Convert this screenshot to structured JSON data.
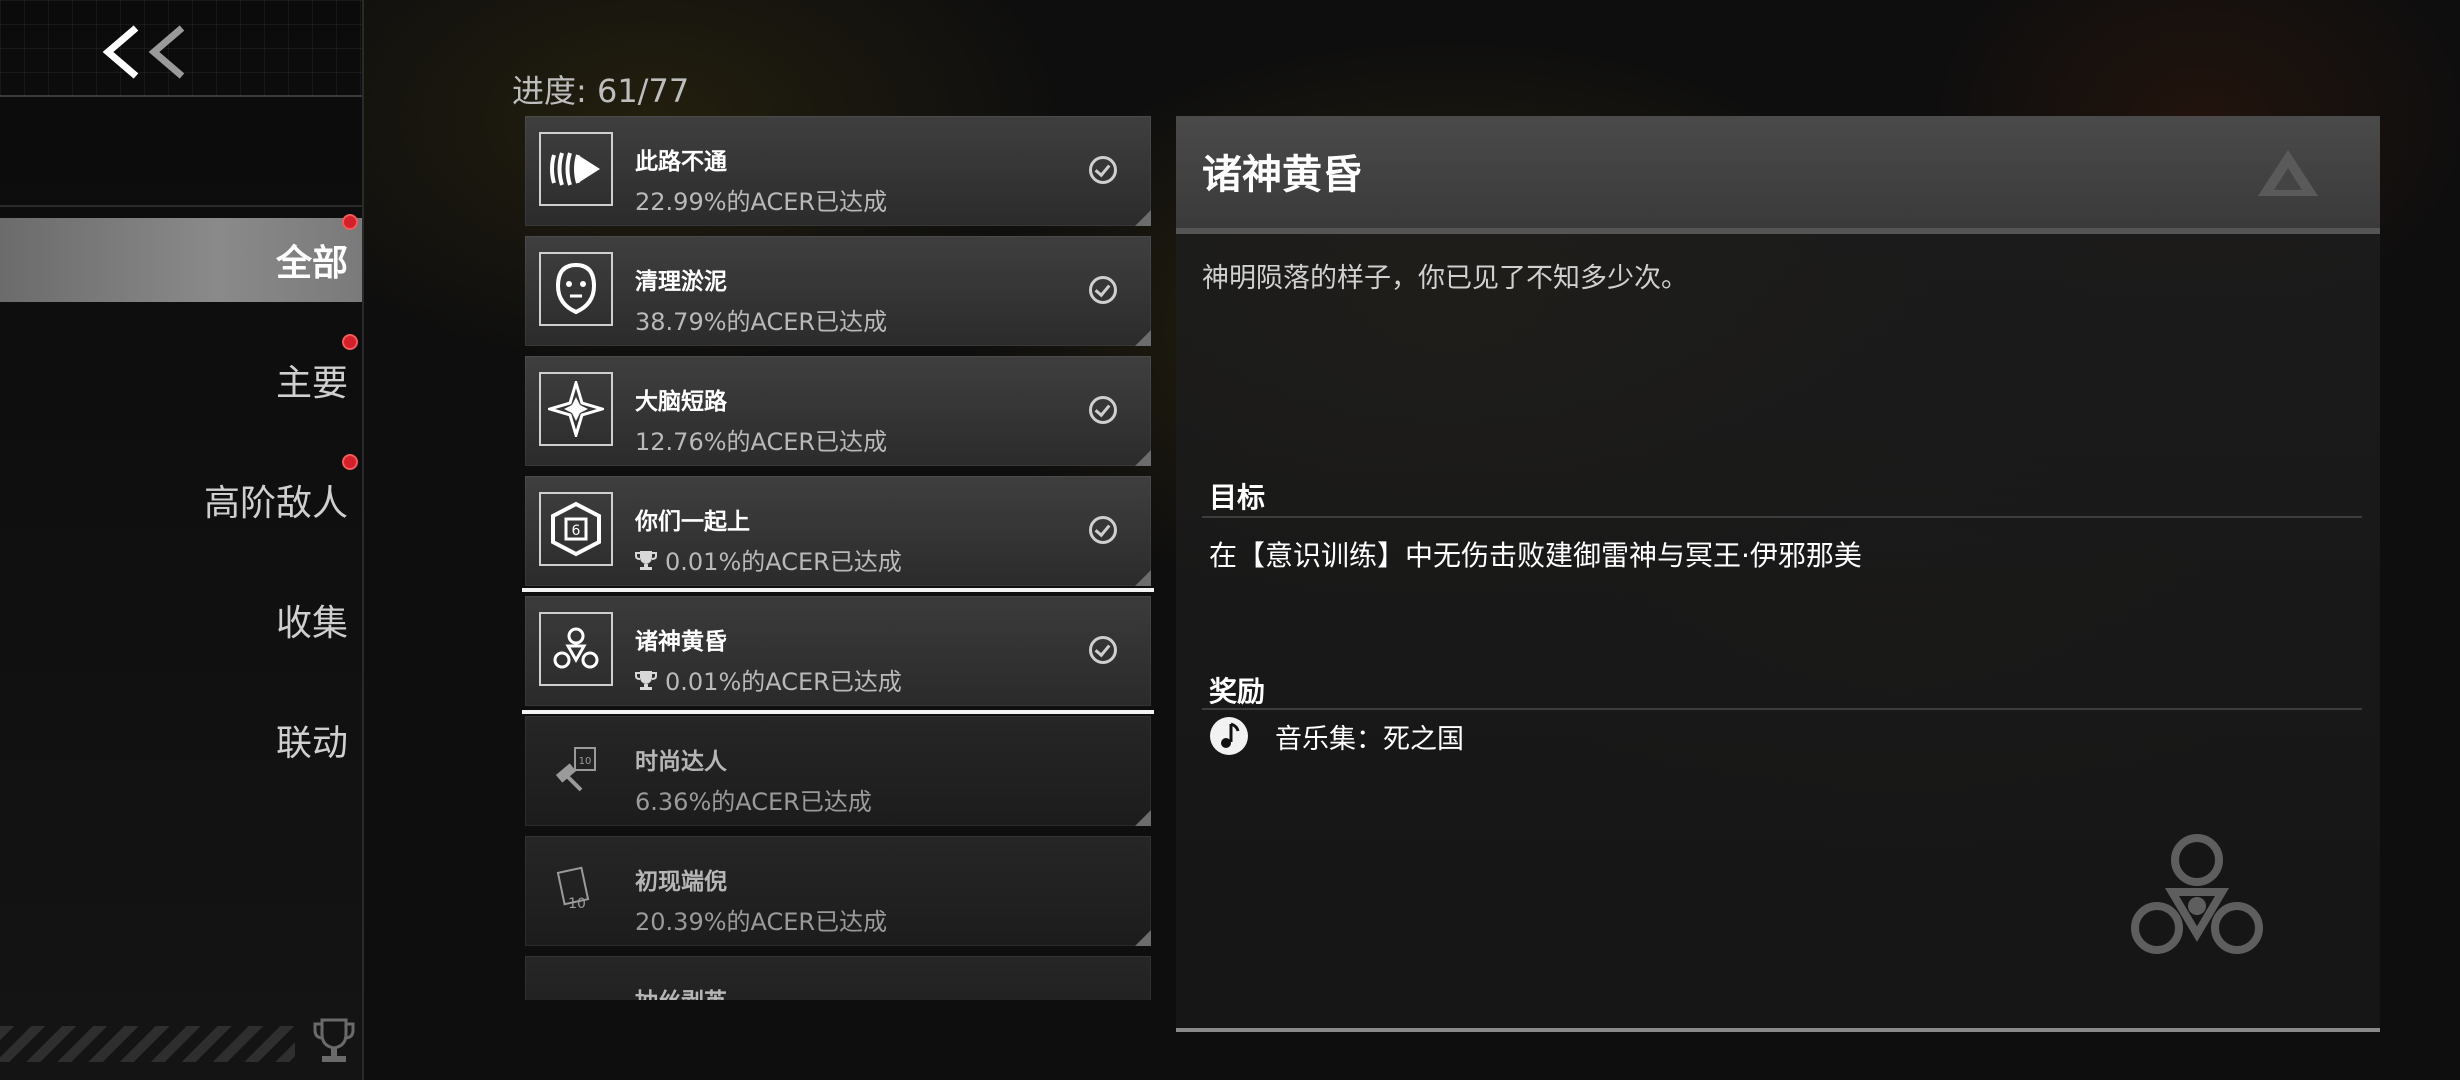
{
  "sidebar": {
    "back_icon": "double-chevron-left-icon",
    "items": [
      {
        "label": "全部",
        "active": true,
        "badge": true
      },
      {
        "label": "主要",
        "active": false,
        "badge": true
      },
      {
        "label": "高阶敌人",
        "active": false,
        "badge": true
      },
      {
        "label": "收集",
        "active": false,
        "badge": false
      },
      {
        "label": "联动",
        "active": false,
        "badge": false
      }
    ],
    "footer_icon": "trophy-icon"
  },
  "progress": {
    "text": "进度: 61/77"
  },
  "achievements": [
    {
      "title": "此路不通",
      "rate": "22.99%的ACER已达成",
      "icon": "fan-blade-icon",
      "completed": true,
      "trophy": false,
      "locked": false
    },
    {
      "title": "清理淤泥",
      "rate": "38.79%的ACER已达成",
      "icon": "mask-face-icon",
      "completed": true,
      "trophy": false,
      "locked": false
    },
    {
      "title": "大脑短路",
      "rate": "12.76%的ACER已达成",
      "icon": "star-burst-icon",
      "completed": true,
      "trophy": false,
      "locked": false
    },
    {
      "title": "你们一起上",
      "rate": "0.01%的ACER已达成",
      "icon": "hexagon-badge-icon",
      "completed": true,
      "trophy": true,
      "locked": false
    },
    {
      "title": "诸神黄昏",
      "rate": "0.01%的ACER已达成",
      "icon": "triad-emblem-icon",
      "completed": true,
      "trophy": true,
      "locked": false,
      "selected": true
    },
    {
      "title": "时尚达人",
      "rate": "6.36%的ACER已达成",
      "icon": "hammer-card-icon",
      "completed": false,
      "trophy": false,
      "locked": true
    },
    {
      "title": "初现端倪",
      "rate": "20.39%的ACER已达成",
      "icon": "card-10-icon",
      "completed": false,
      "trophy": false,
      "locked": true
    },
    {
      "title": "抽丝剥茧",
      "rate": "",
      "icon": "arrow-icon",
      "completed": false,
      "trophy": false,
      "locked": true
    }
  ],
  "detail": {
    "title": "诸神黄昏",
    "description": "神明陨落的样子，你已见了不知多少次。",
    "goal_label": "目标",
    "goal_text": "在【意识训练】中无伤击败建御雷神与冥王·伊邪那美",
    "reward_label": "奖励",
    "reward_icon": "music-note-icon",
    "reward_text": "音乐集：死之国"
  },
  "colors": {
    "badge": "#d4202b",
    "selected_outline": "#f2f2f2",
    "active_nav": "#7a7a7a"
  }
}
